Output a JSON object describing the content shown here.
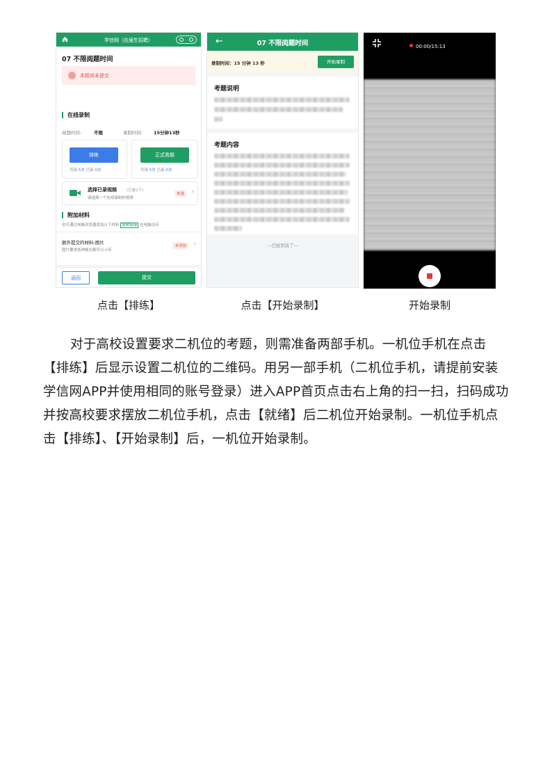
{
  "screens": {
    "screen1": {
      "topbar_title": "学信网（应届生招聘）",
      "page_title": "07 不限阅题时间",
      "warning": "本题尚未提交",
      "online_record": {
        "title": "在线录制",
        "read_time_label": "阅题时间:",
        "read_time_value": "不限",
        "record_time_label": "录制时间:",
        "record_time_value": "15分钟13秒",
        "practice_button": "排练",
        "formal_button": "正式答题",
        "practice_usage": [
          "可用",
          "5次",
          "已用",
          "0次"
        ],
        "formal_usage": [
          "可用",
          "5次",
          "已用",
          "0次"
        ],
        "choose_video_title": "选择已录视频",
        "choose_video_count": "(已录2个)",
        "choose_video_sub": "请选择一个在线录制的视频",
        "choose_video_tag": "未选"
      },
      "materials": {
        "title": "附加材料",
        "desc_before": "也可通过电脑浏览器添加以下材料",
        "desc_link": "复制链接",
        "desc_after": "在电脑访问",
        "item_title": "额外提交的材料-图片",
        "item_sub": "图片要求各种格式都可以上传",
        "item_tag": "未添加"
      },
      "back_button": "返回",
      "submit_button": "提交"
    },
    "screen2": {
      "title": "07 不限阅题时间",
      "record_time": "录制时间：15 分钟 13 秒",
      "start_button": "开始录制",
      "section1_title": "考题说明",
      "section2_title": "考题内容",
      "end_text": "—已经到底了—"
    },
    "screen3": {
      "timer": "00:00/15:13"
    }
  },
  "captions": {
    "c1": "点击【排练】",
    "c2": "点击【开始录制】",
    "c3": "开始录制"
  },
  "paragraph": "对于高校设置要求二机位的考题，则需准备两部手机。一机位手机在点击【排练】后显示设置二机位的二维码。用另一部手机（二机位手机，请提前安装学信网APP并使用相同的账号登录）进入APP首页点击右上角的扫一扫，扫码成功并按高校要求摆放二机位手机，点击【就绪】后二机位开始录制。一机位手机点击【排练】、【开始录制】后，一机位开始录制。",
  "colors": {
    "brand_green": "#1f9e63",
    "blue": "#3b7ce8",
    "warn_red": "#e65145"
  }
}
